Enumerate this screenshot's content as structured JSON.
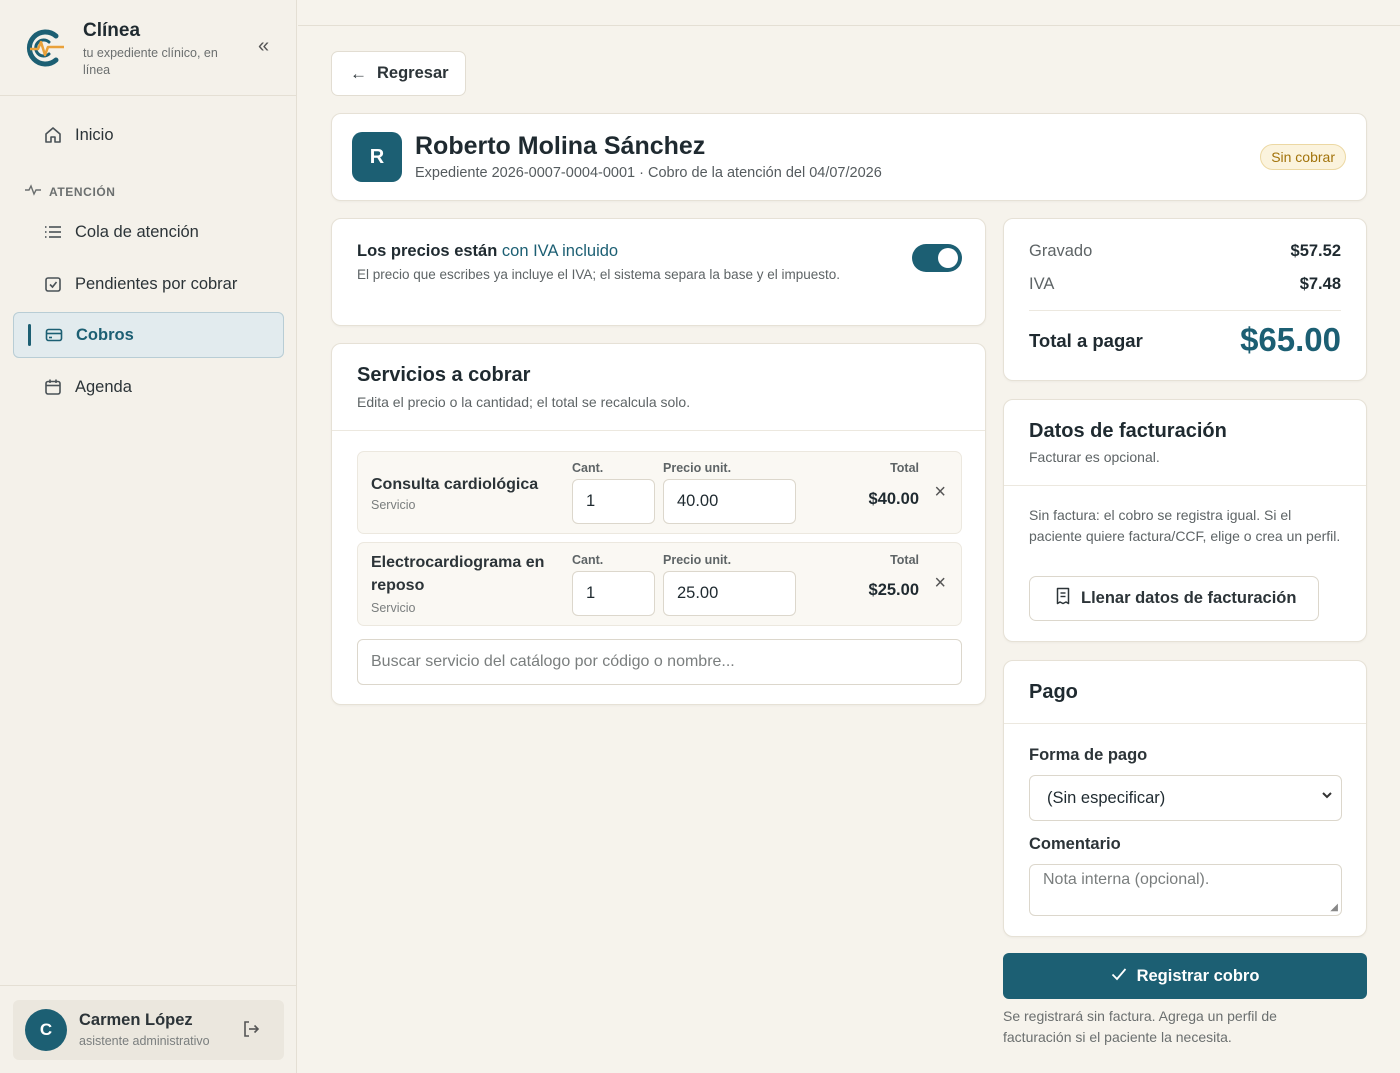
{
  "brand": {
    "name": "Clínea",
    "tagline": "tu expediente clínico, en línea"
  },
  "sidebar": {
    "items": [
      {
        "label": "Inicio",
        "icon": "home-icon"
      },
      {
        "label": "Cola de atención",
        "icon": "list-icon"
      },
      {
        "label": "Pendientes por cobrar",
        "icon": "check-square-icon"
      },
      {
        "label": "Cobros",
        "icon": "credit-card-icon",
        "active": true
      },
      {
        "label": "Agenda",
        "icon": "calendar-icon"
      }
    ],
    "section_label": "ATENCIÓN"
  },
  "user": {
    "initial": "C",
    "name": "Carmen López",
    "role": "asistente administrativo"
  },
  "back_label": "Regresar",
  "patient": {
    "initial": "R",
    "name": "Roberto Molina Sánchez",
    "subtitle": "Expediente 2026-0007-0004-0001 · Cobro de la atención del 04/07/2026",
    "status": "Sin cobrar"
  },
  "iva": {
    "title_prefix": "Los precios están",
    "title_highlight": "con IVA incluido",
    "description": "El precio que escribes ya incluye el IVA; el sistema separa la base y el impuesto.",
    "enabled": true
  },
  "services": {
    "title": "Servicios a cobrar",
    "subtitle": "Edita el precio o la cantidad; el total se recalcula solo.",
    "col_qty": "Cant.",
    "col_price": "Precio unit.",
    "col_total": "Total",
    "rows": [
      {
        "name": "Consulta cardiológica",
        "kind": "Servicio",
        "qty": "1",
        "price": "40.00",
        "total": "$40.00"
      },
      {
        "name": "Electrocardiograma en reposo",
        "kind": "Servicio",
        "qty": "1",
        "price": "25.00",
        "total": "$25.00"
      }
    ],
    "search_placeholder": "Buscar servicio del catálogo por código o nombre..."
  },
  "totals": {
    "gravado_label": "Gravado",
    "gravado": "$57.52",
    "iva_label": "IVA",
    "iva": "$7.48",
    "total_label": "Total a pagar",
    "total": "$65.00"
  },
  "billing": {
    "title": "Datos de facturación",
    "subtitle": "Facturar es opcional.",
    "description": "Sin factura: el cobro se registra igual. Si el paciente quiere factura/CCF, elige o crea un perfil.",
    "button": "Llenar datos de facturación"
  },
  "payment": {
    "title": "Pago",
    "method_label": "Forma de pago",
    "method_value": "(Sin especificar)",
    "comment_label": "Comentario",
    "comment_placeholder": "Nota interna (opcional)."
  },
  "submit_label": "Registrar cobro",
  "footer_note": "Se registrará sin factura. Agrega un perfil de facturación si el paciente la necesita.",
  "colors": {
    "accent": "#1c5f73",
    "badge_text": "#a2730b",
    "logo_orange": "#e9a13a"
  }
}
